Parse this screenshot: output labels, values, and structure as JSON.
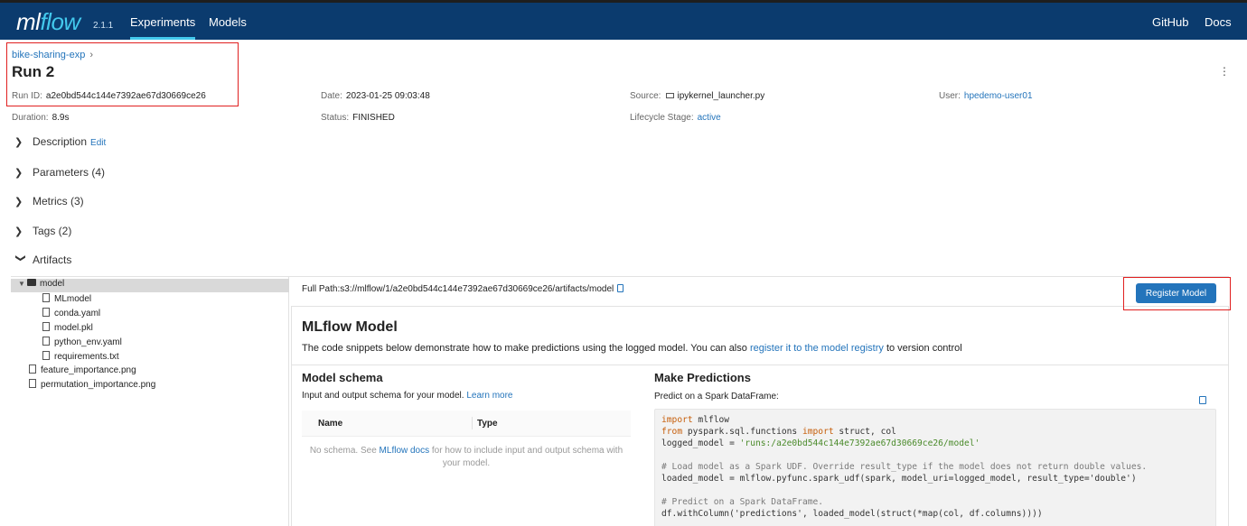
{
  "header": {
    "logo_ml": "ml",
    "logo_flow": "flow",
    "version": "2.1.1",
    "nav": [
      "Experiments",
      "Models"
    ],
    "right_links": [
      "GitHub",
      "Docs"
    ]
  },
  "breadcrumb": {
    "experiment": "bike-sharing-exp",
    "chevron": "›"
  },
  "run": {
    "title": "Run 2",
    "run_id_label": "Run ID:",
    "run_id": "a2e0bd544c144e7392ae67d30669ce26",
    "date_label": "Date:",
    "date": "2023-01-25 09:03:48",
    "source_label": "Source:",
    "source": "ipykernel_launcher.py",
    "user_label": "User:",
    "user": "hpedemo-user01",
    "duration_label": "Duration:",
    "duration": "8.9s",
    "status_label": "Status:",
    "status": "FINISHED",
    "lifecycle_label": "Lifecycle Stage:",
    "lifecycle": "active"
  },
  "sections": {
    "description": "Description",
    "edit": "Edit",
    "parameters": "Parameters (4)",
    "metrics": "Metrics (3)",
    "tags": "Tags (2)",
    "artifacts": "Artifacts"
  },
  "tree": {
    "root": "model",
    "children": [
      "MLmodel",
      "conda.yaml",
      "model.pkl",
      "python_env.yaml",
      "requirements.txt"
    ],
    "files": [
      "feature_importance.png",
      "permutation_importance.png"
    ]
  },
  "pane": {
    "full_path": "Full Path:s3://mlflow/1/a2e0bd544c144e7392ae67d30669ce26/artifacts/model",
    "register_button": "Register Model",
    "ml_title": "MLflow Model",
    "ml_desc_pre": "The code snippets below demonstrate how to make predictions using the logged model. You can also ",
    "ml_desc_link": "register it to the model registry",
    "ml_desc_post": " to version control",
    "schema_title": "Model schema",
    "schema_sub": "Input and output schema for your model. ",
    "schema_learn": "Learn more",
    "col_name": "Name",
    "col_type": "Type",
    "no_schema_pre": "No schema. See ",
    "no_schema_link": "MLflow docs",
    "no_schema_post": " for how to include input and output schema with your model.",
    "predict_title": "Make Predictions",
    "predict_sub": "Predict on a Spark DataFrame:"
  },
  "code": {
    "l1_kw": "import",
    "l1_rest": " mlflow",
    "l2_kw1": "from",
    "l2_mid": " pyspark.sql.functions ",
    "l2_kw2": "import",
    "l2_rest": " struct, col",
    "l3_pre": "logged_model = ",
    "l3_str": "'runs:/a2e0bd544c144e7392ae67d30669ce26/model'",
    "l5_cm": "# Load model as a Spark UDF. Override result_type if the model does not return double values.",
    "l6": "loaded_model = mlflow.pyfunc.spark_udf(spark, model_uri=logged_model, result_type='double')",
    "l8_cm": "# Predict on a Spark DataFrame.",
    "l9": "df.withColumn('predictions', loaded_model(struct(*map(col, df.columns))))"
  }
}
